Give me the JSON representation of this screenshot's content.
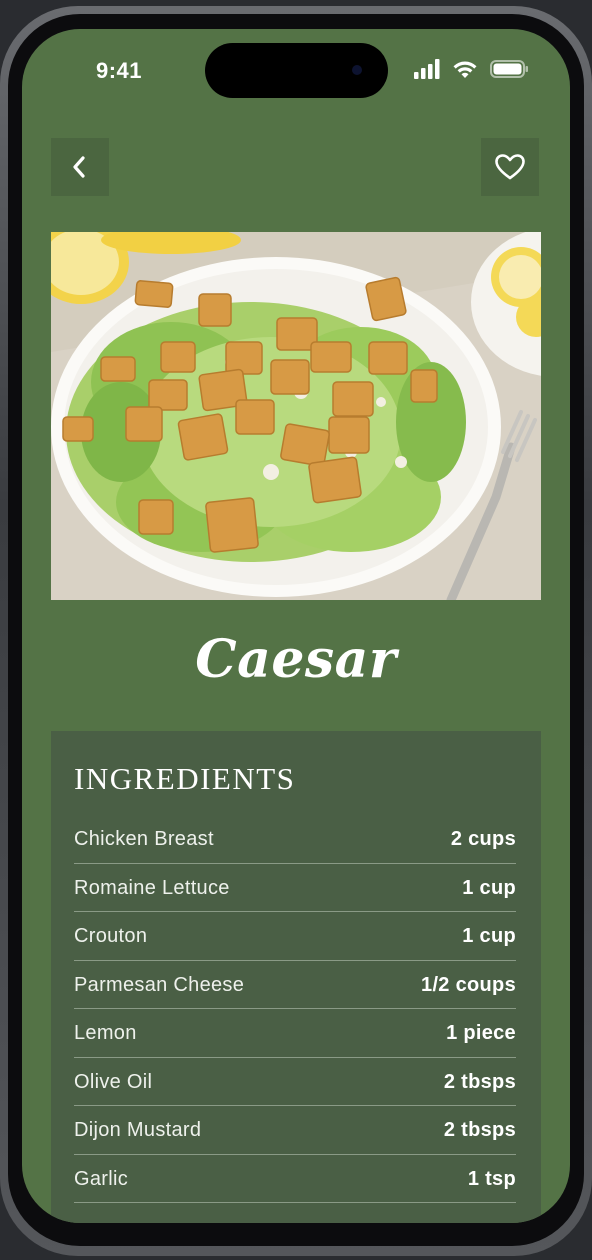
{
  "status_bar": {
    "time": "9:41"
  },
  "navigation": {
    "back_icon": "chevron-left-icon",
    "favorite_icon": "heart-icon"
  },
  "recipe": {
    "title": "Caesar",
    "image": "caesar-salad-photo"
  },
  "ingredients": {
    "heading": "INGREDIENTS",
    "items": [
      {
        "name": "Chicken Breast",
        "quantity": "2 cups"
      },
      {
        "name": "Romaine Lettuce",
        "quantity": "1 cup"
      },
      {
        "name": "Crouton",
        "quantity": "1 cup"
      },
      {
        "name": "Parmesan Cheese",
        "quantity": "1/2 coups"
      },
      {
        "name": "Lemon",
        "quantity": "1 piece"
      },
      {
        "name": "Olive Oil",
        "quantity": "2 tbsps"
      },
      {
        "name": "Dijon Mustard",
        "quantity": "2 tbsps"
      },
      {
        "name": "Garlic",
        "quantity": "1 tsp"
      }
    ]
  },
  "colors": {
    "screen_background": "#547346",
    "card_background": "#4a5f45",
    "button_background": "#4b6640",
    "text": "#ffffff"
  }
}
